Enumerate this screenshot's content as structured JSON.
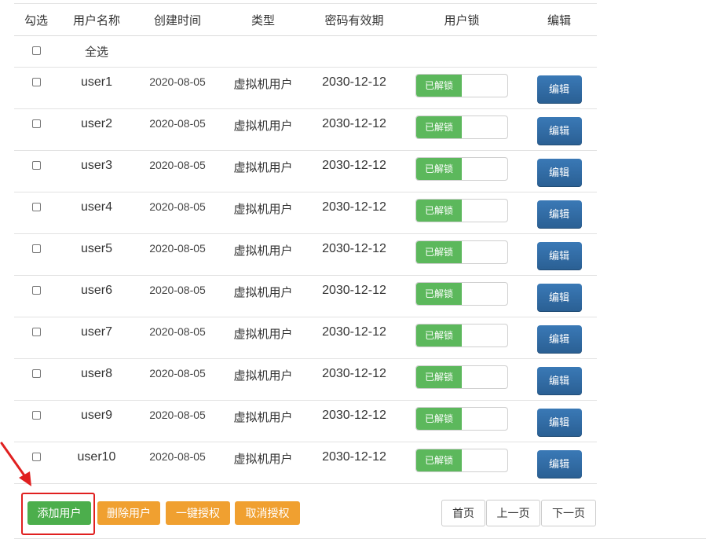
{
  "table": {
    "headers": [
      "勾选",
      "用户名称",
      "创建时间",
      "类型",
      "密码有效期",
      "用户锁",
      "编辑"
    ],
    "select_all_label": "全选",
    "rows": [
      {
        "name": "user1",
        "created": "2020-08-05",
        "type": "虚拟机用户",
        "expire": "2030-12-12",
        "lock": "已解锁",
        "edit": "编辑"
      },
      {
        "name": "user2",
        "created": "2020-08-05",
        "type": "虚拟机用户",
        "expire": "2030-12-12",
        "lock": "已解锁",
        "edit": "编辑"
      },
      {
        "name": "user3",
        "created": "2020-08-05",
        "type": "虚拟机用户",
        "expire": "2030-12-12",
        "lock": "已解锁",
        "edit": "编辑"
      },
      {
        "name": "user4",
        "created": "2020-08-05",
        "type": "虚拟机用户",
        "expire": "2030-12-12",
        "lock": "已解锁",
        "edit": "编辑"
      },
      {
        "name": "user5",
        "created": "2020-08-05",
        "type": "虚拟机用户",
        "expire": "2030-12-12",
        "lock": "已解锁",
        "edit": "编辑"
      },
      {
        "name": "user6",
        "created": "2020-08-05",
        "type": "虚拟机用户",
        "expire": "2030-12-12",
        "lock": "已解锁",
        "edit": "编辑"
      },
      {
        "name": "user7",
        "created": "2020-08-05",
        "type": "虚拟机用户",
        "expire": "2030-12-12",
        "lock": "已解锁",
        "edit": "编辑"
      },
      {
        "name": "user8",
        "created": "2020-08-05",
        "type": "虚拟机用户",
        "expire": "2030-12-12",
        "lock": "已解锁",
        "edit": "编辑"
      },
      {
        "name": "user9",
        "created": "2020-08-05",
        "type": "虚拟机用户",
        "expire": "2030-12-12",
        "lock": "已解锁",
        "edit": "编辑"
      },
      {
        "name": "user10",
        "created": "2020-08-05",
        "type": "虚拟机用户",
        "expire": "2030-12-12",
        "lock": "已解锁",
        "edit": "编辑"
      }
    ]
  },
  "actions": {
    "add_user": "添加用户",
    "delete_user": "删除用户",
    "grant_all": "一键授权",
    "revoke": "取消授权"
  },
  "pagination": {
    "first": "首页",
    "prev": "上一页",
    "next": "下一页"
  },
  "colors": {
    "success": "#5cb85c",
    "warning": "#f0a030",
    "primary": "#2f6da6",
    "annotation": "#e02020"
  },
  "annotation": {
    "arrow_icon": "red-arrow-icon",
    "highlight": "add-user-highlight-box"
  }
}
